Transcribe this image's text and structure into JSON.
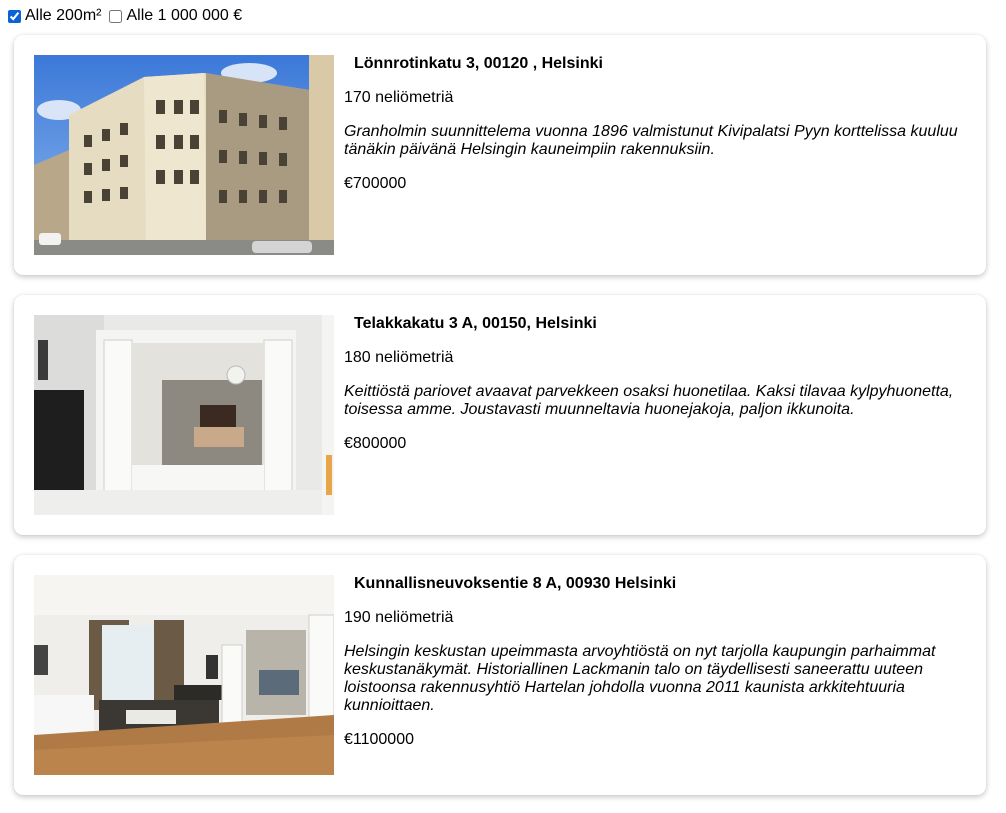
{
  "filters": {
    "area": {
      "label": "Alle 200m²",
      "checked": true
    },
    "price": {
      "label": "Alle 1 000 000 €",
      "checked": false
    }
  },
  "listings": [
    {
      "address": "Lönnrotinkatu 3, 00120 , Helsinki",
      "area": "170 neliömetriä",
      "description": "Granholmin suunnittelema vuonna 1896 valmistunut Kivipalatsi Pyyn korttelissa kuuluu tänäkin päivänä Helsingin kauneimpiin rakennuksiin.",
      "price": "€700000",
      "image": "building-exterior-photo"
    },
    {
      "address": "Telakkakatu 3 A, 00150, Helsinki",
      "area": "180 neliömetriä",
      "description": "Keittiöstä pariovet avaavat parvekkeen osaksi huonetilaa. Kaksi tilavaa kylpyhuonetta, toisessa amme. Joustavasti muunneltavia huonejakoja, paljon ikkunoita.",
      "price": "€800000",
      "image": "bedroom-interior-photo"
    },
    {
      "address": "Kunnallisneuvoksentie 8 A, 00930 Helsinki",
      "area": "190 neliömetriä",
      "description": "Helsingin keskustan upeimmasta arvoyhtiöstä on nyt tarjolla kaupungin parhaimmat keskustanäkymät. Historiallinen Lackmanin talo on täydellisesti saneerattu uuteen loistoonsa rakennusyhtiö Hartelan johdolla vuonna 2011 kaunista arkkitehtuuria kunnioittaen.",
      "price": "€1100000",
      "image": "living-room-interior-photo"
    }
  ]
}
